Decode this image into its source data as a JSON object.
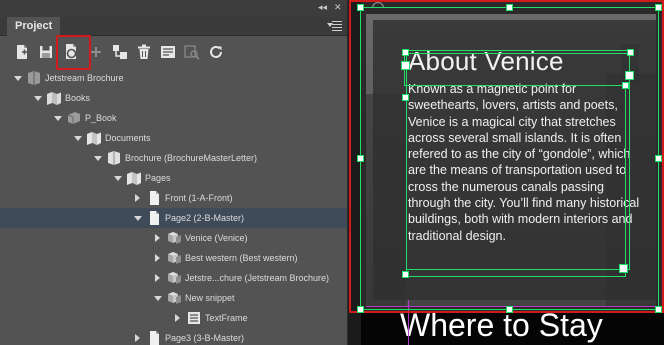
{
  "panel": {
    "tab_label": "Project",
    "topbar": {
      "collapse_glyph": "◂◂",
      "close_glyph": "✕"
    },
    "menu_icon": "panel-menu-icon",
    "toolbar": [
      {
        "name": "new-page-icon",
        "active": false
      },
      {
        "name": "save-icon",
        "active": false
      },
      {
        "name": "convert-icon",
        "active": true
      },
      {
        "name": "add-icon",
        "active": false
      },
      {
        "name": "add-child-icon",
        "active": false
      },
      {
        "name": "delete-icon",
        "active": false
      },
      {
        "name": "properties-icon",
        "active": false
      },
      {
        "name": "inspect-icon",
        "active": false
      },
      {
        "name": "refresh-icon",
        "active": false
      }
    ]
  },
  "tree": [
    {
      "label": "Jetstream Brochure",
      "icon": "project-icon",
      "twisty": "down",
      "level": 0,
      "selected": false
    },
    {
      "label": "Books",
      "icon": "books-icon",
      "twisty": "down",
      "level": 1,
      "selected": false
    },
    {
      "label": "P_Book",
      "icon": "book-icon",
      "twisty": "down",
      "level": 2,
      "selected": false
    },
    {
      "label": "Documents",
      "icon": "documents-icon",
      "twisty": "down",
      "level": 3,
      "selected": false
    },
    {
      "label": "Brochure (BrochureMasterLetter)",
      "icon": "document-icon",
      "twisty": "down",
      "level": 4,
      "selected": false
    },
    {
      "label": "Pages",
      "icon": "pages-icon",
      "twisty": "down",
      "level": 5,
      "selected": false
    },
    {
      "label": "Front (1-A-Front)",
      "icon": "page-icon",
      "twisty": "right",
      "level": 6,
      "selected": false
    },
    {
      "label": "Page2 (2-B-Master)",
      "icon": "page-icon",
      "twisty": "down",
      "level": 6,
      "selected": true
    },
    {
      "label": "Venice (Venice)",
      "icon": "snippet-icon",
      "twisty": "right",
      "level": 7,
      "selected": false
    },
    {
      "label": "Best western (Best western)",
      "icon": "snippet-icon",
      "twisty": "right",
      "level": 7,
      "selected": false
    },
    {
      "label": "Jetstre...chure (Jetstream Brochure)",
      "icon": "snippet-icon",
      "twisty": "right",
      "level": 7,
      "selected": false
    },
    {
      "label": "New snippet",
      "icon": "snippet-icon",
      "twisty": "down",
      "level": 7,
      "selected": false
    },
    {
      "label": "TextFrame",
      "icon": "textframe-icon",
      "twisty": "right",
      "level": 8,
      "selected": false
    },
    {
      "label": "Page3 (3-B-Master)",
      "icon": "page-icon",
      "twisty": "right",
      "level": 6,
      "selected": false
    }
  ],
  "document": {
    "heading": "About Venice",
    "body": "Known as a magnetic point for sweethearts, lovers, artists and poets, Venice is a magical city that stretches across several small islands. It is often refered to as the city of “gondole”, which are the means of transportation used to cross the numerous canals passing through the city. You’ll find many historical buildings, both with modern interiors and traditional design.",
    "next_heading": "Where to Stay"
  },
  "colors": {
    "selection_frame": "#21e06a",
    "highlight": "#d11b1b",
    "selected_row": "#3f4b59",
    "guide": "#b23cc8"
  }
}
